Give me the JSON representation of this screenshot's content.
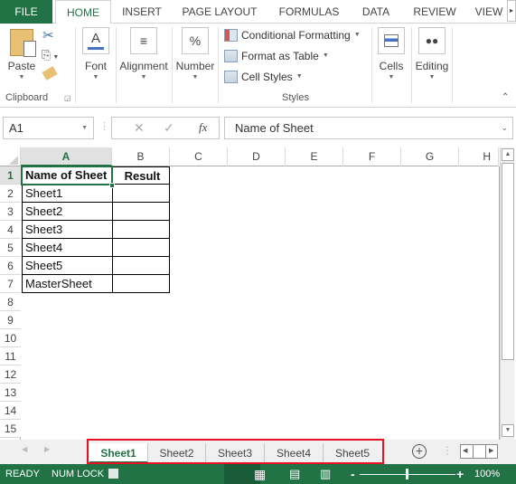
{
  "ribbon_tabs": [
    "FILE",
    "HOME",
    "INSERT",
    "PAGE LAYOUT",
    "FORMULAS",
    "DATA",
    "REVIEW",
    "VIEW"
  ],
  "active_tab": "HOME",
  "clipboard": {
    "paste": "Paste",
    "group": "Clipboard"
  },
  "groups": {
    "font": "Font",
    "alignment": "Alignment",
    "number": "Number",
    "cells": "Cells",
    "editing": "Editing",
    "styles": "Styles"
  },
  "styles_items": [
    "Conditional Formatting",
    "Format as Table",
    "Cell Styles"
  ],
  "formula_bar": {
    "name_box": "A1",
    "fx": "fx",
    "content": "Name of Sheet"
  },
  "columns": [
    "A",
    "B",
    "C",
    "D",
    "E",
    "F",
    "G",
    "H"
  ],
  "rows": [
    "1",
    "2",
    "3",
    "4",
    "5",
    "6",
    "7",
    "8",
    "9",
    "10",
    "11",
    "12",
    "13",
    "14",
    "15"
  ],
  "table": {
    "headers": [
      "Name of Sheet",
      "Result"
    ],
    "rows": [
      [
        "Sheet1",
        ""
      ],
      [
        "Sheet2",
        ""
      ],
      [
        "Sheet3",
        ""
      ],
      [
        "Sheet4",
        ""
      ],
      [
        "Sheet5",
        ""
      ],
      [
        "MasterSheet",
        ""
      ]
    ]
  },
  "sheet_tabs": [
    "Sheet1",
    "Sheet2",
    "Sheet3",
    "Sheet4",
    "Sheet5"
  ],
  "active_sheet": "Sheet1",
  "status": {
    "ready": "READY",
    "numlock": "NUM LOCK",
    "zoom": "100%"
  },
  "colors": {
    "accent": "#217346",
    "highlight": "#e81123"
  }
}
